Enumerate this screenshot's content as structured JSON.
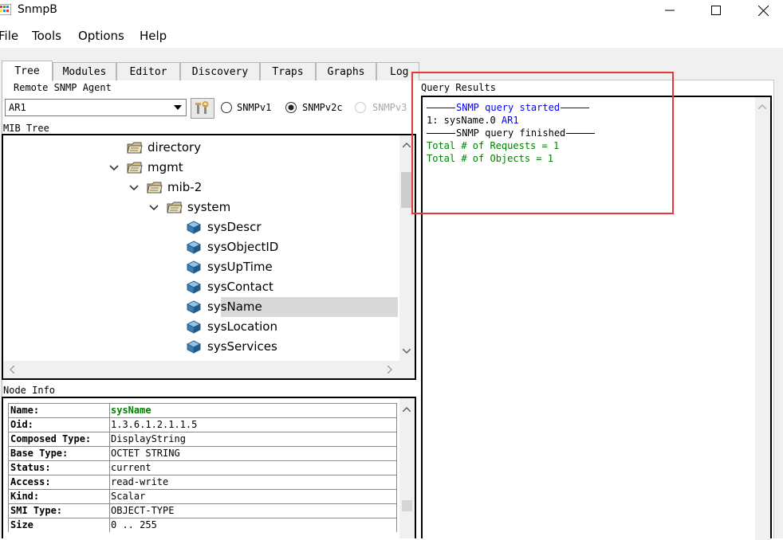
{
  "window": {
    "title": "SnmpB"
  },
  "menu": [
    "File",
    "Tools",
    "Options",
    "Help"
  ],
  "tabs": [
    "Tree",
    "Modules",
    "Editor",
    "Discovery",
    "Traps",
    "Graphs",
    "Log"
  ],
  "agent": {
    "section_label": "Remote SNMP Agent",
    "selected": "AR1",
    "versions": [
      {
        "label": "SNMPv1",
        "checked": false,
        "enabled": true
      },
      {
        "label": "SNMPv2c",
        "checked": true,
        "enabled": true
      },
      {
        "label": "SNMPv3",
        "checked": false,
        "enabled": false
      }
    ]
  },
  "mib_tree": {
    "section_label": "MIB Tree",
    "nodes": [
      {
        "label": "directory",
        "kind": "folder",
        "level": 0,
        "expanded": false
      },
      {
        "label": "mgmt",
        "kind": "folder",
        "level": 0,
        "expanded": true
      },
      {
        "label": "mib-2",
        "kind": "folder",
        "level": 1,
        "expanded": true
      },
      {
        "label": "system",
        "kind": "folder",
        "level": 2,
        "expanded": true
      },
      {
        "label": "sysDescr",
        "kind": "leaf",
        "level": 3
      },
      {
        "label": "sysObjectID",
        "kind": "leaf",
        "level": 3
      },
      {
        "label": "sysUpTime",
        "kind": "leaf",
        "level": 3
      },
      {
        "label": "sysContact",
        "kind": "leaf",
        "level": 3
      },
      {
        "label": "sysName",
        "kind": "leaf",
        "level": 3,
        "selected": true
      },
      {
        "label": "sysLocation",
        "kind": "leaf",
        "level": 3
      },
      {
        "label": "sysServices",
        "kind": "leaf",
        "level": 3
      }
    ]
  },
  "node_info": {
    "section_label": "Node Info",
    "rows": [
      {
        "key": "Name:",
        "value": "sysName",
        "highlight": true
      },
      {
        "key": "Oid:",
        "value": "1.3.6.1.2.1.1.5"
      },
      {
        "key": "Composed Type:",
        "value": "DisplayString"
      },
      {
        "key": "Base Type:",
        "value": "OCTET STRING"
      },
      {
        "key": "Status:",
        "value": "current"
      },
      {
        "key": "Access:",
        "value": "read-write"
      },
      {
        "key": "Kind:",
        "value": "Scalar"
      },
      {
        "key": "SMI Type:",
        "value": "OBJECT-TYPE"
      },
      {
        "key": "Size",
        "value": "0 .. 255"
      }
    ]
  },
  "query_results": {
    "section_label": "Query Results",
    "started": "SNMP query started",
    "result_prefix": "1: sysName.0 ",
    "result_value": "AR1",
    "finished": "SNMP query finished",
    "requests": "Total # of Requests = 1",
    "objects": "Total # of Objects = 1"
  },
  "colors": {
    "blue": "#0000ff",
    "green": "#008000",
    "highlight_box": "#e53935",
    "selection": "#d9d9d9"
  }
}
